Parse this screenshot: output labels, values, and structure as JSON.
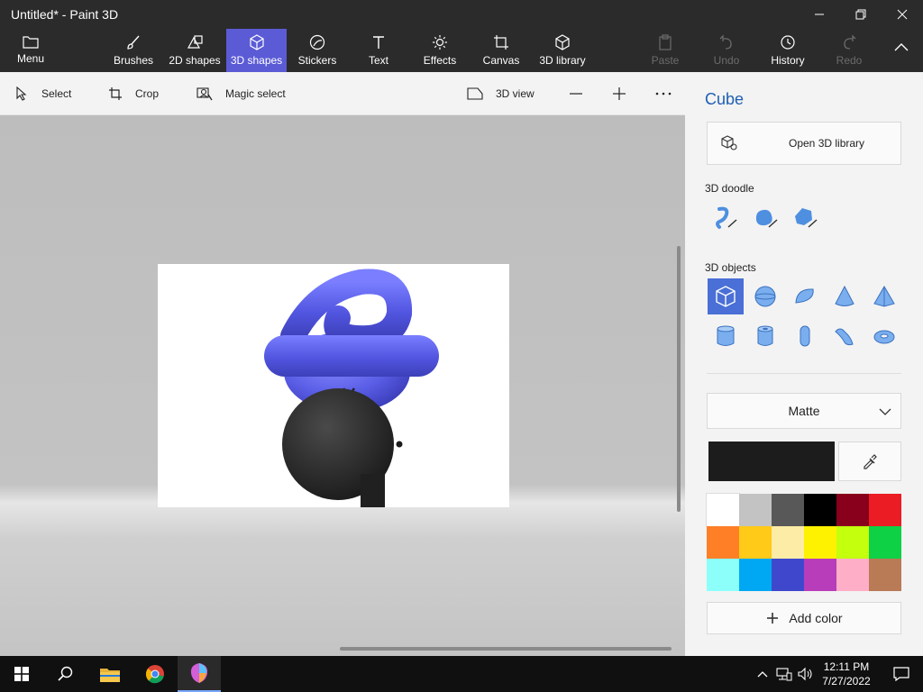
{
  "window": {
    "title": "Untitled* - Paint 3D"
  },
  "ribbon": {
    "menu": "Menu",
    "brushes": "Brushes",
    "shapes2d": "2D shapes",
    "shapes3d": "3D shapes",
    "stickers": "Stickers",
    "text": "Text",
    "effects": "Effects",
    "canvas": "Canvas",
    "library3d": "3D library",
    "paste": "Paste",
    "undo": "Undo",
    "history": "History",
    "redo": "Redo",
    "active_tab": "3D shapes"
  },
  "toolbar": {
    "select": "Select",
    "crop": "Crop",
    "magic_select": "Magic select",
    "view3d": "3D view"
  },
  "panel": {
    "title": "Cube",
    "open_library": "Open 3D library",
    "doodle_label": "3D doodle",
    "objects_label": "3D objects",
    "material": "Matte",
    "current_color": "#1c1c1c",
    "add_color": "Add color",
    "palette": [
      "#ffffff",
      "#c3c3c3",
      "#585858",
      "#000000",
      "#88001b",
      "#ec1c24",
      "#ff7f27",
      "#ffca18",
      "#fdeca6",
      "#fff200",
      "#c4ff0e",
      "#0ed145",
      "#8cfffb",
      "#00a8f3",
      "#3f48cc",
      "#b83dba",
      "#ffaec8",
      "#b97a56"
    ]
  },
  "taskbar": {
    "time": "12:11 PM",
    "date": "7/27/2022"
  }
}
